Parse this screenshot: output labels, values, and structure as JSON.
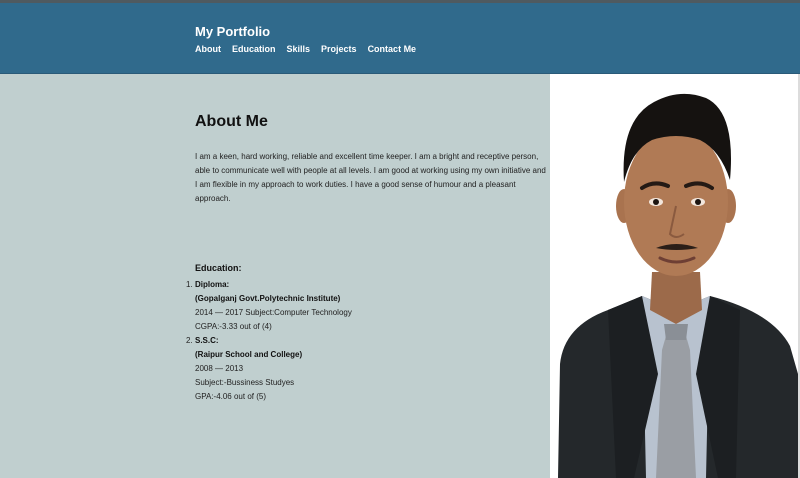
{
  "header": {
    "site_title": "My Portfolio",
    "nav": [
      "About",
      "Education",
      "Skills",
      "Projects",
      "Contact Me"
    ]
  },
  "about": {
    "heading": "About Me",
    "text": "I am a keen, hard working, reliable and excellent time keeper. I am a bright and receptive person, able to communicate well with people at all levels. I am good at working using my own initiative and I am flexible in my approach to work duties. I have a good sense of humour and a pleasant approach."
  },
  "education": {
    "heading": "Education:",
    "items": [
      {
        "number": "1.",
        "degree": "Diploma:",
        "institute": "(Gopalganj Govt.Polytechnic Institute)",
        "details": [
          "2014 — 2017 Subject:Computer Technology",
          "CGPA:-3.33 out of (4)"
        ]
      },
      {
        "number": "2.",
        "degree": "S.S.C:",
        "institute": "(Raipur School and College)",
        "details": [
          "2008 — 2013",
          "Subject:-Bussiness Studyes",
          "GPA:-4.06 out of (5)"
        ]
      }
    ]
  },
  "colors": {
    "header_bg": "#306a8c",
    "main_bg": "#c0cfcf",
    "photo_bg": "#ffffff",
    "suit": "#24282b",
    "shirt": "#b8c2cf",
    "tie": "#9a9ea4"
  }
}
